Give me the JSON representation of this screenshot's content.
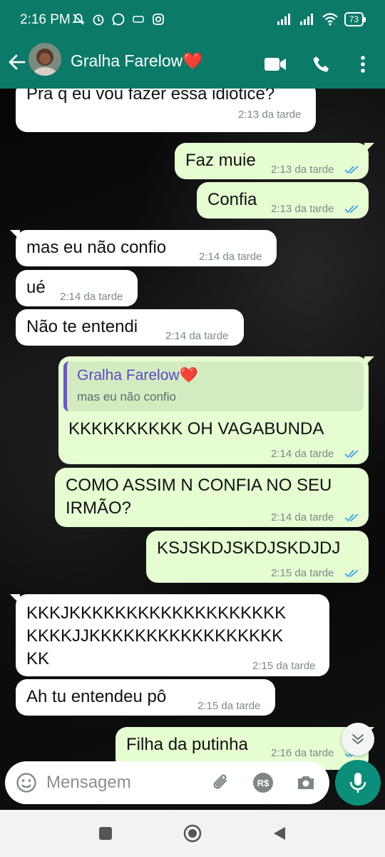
{
  "status_bar": {
    "time": "2:16 PM",
    "battery": "73"
  },
  "header": {
    "contact_name": "Gralha Farelow❤️"
  },
  "messages": [
    {
      "text": "Pra q eu vou fazer essa idiotice?",
      "time": "2:13 da tarde",
      "direction": "in"
    },
    {
      "text": "Faz muie",
      "time": "2:13 da tarde",
      "direction": "out",
      "read": true
    },
    {
      "text": "Confia",
      "time": "2:13 da tarde",
      "direction": "out",
      "read": true
    },
    {
      "text": "mas eu não confio",
      "time": "2:14 da tarde",
      "direction": "in"
    },
    {
      "text": "ué",
      "time": "2:14 da tarde",
      "direction": "in"
    },
    {
      "text": "Não te entendi",
      "time": "2:14 da tarde",
      "direction": "in"
    },
    {
      "text": "KKKKKKKKKK OH VAGABUNDA",
      "time": "2:14 da tarde",
      "direction": "out",
      "read": true,
      "quoted": {
        "name": "Gralha Farelow❤️",
        "text": "mas eu não confio"
      }
    },
    {
      "text_lines": [
        "COMO ASSIM N CONFIA NO SEU",
        "IRMÃO?"
      ],
      "time": "2:14 da tarde",
      "direction": "out",
      "read": true
    },
    {
      "text": "KSJSKDJSKDJSKDJDJ",
      "time": "2:15 da tarde",
      "direction": "out",
      "read": true
    },
    {
      "text_lines": [
        "KKKJKKKKKKKKKKKKKKKKKKK",
        "KKKKJJKKKKKKKKKKKKKKKKK",
        "KK"
      ],
      "time": "2:15 da tarde",
      "direction": "in"
    },
    {
      "text": "Ah tu entendeu pô",
      "time": "2:15 da tarde",
      "direction": "in"
    },
    {
      "text": "Filha da putinha",
      "time": "2:16 da tarde",
      "direction": "out",
      "read": true
    }
  ],
  "composer": {
    "placeholder": "Mensagem"
  },
  "colors": {
    "header": "#0b7a68",
    "outgoing": "#e6fdd2",
    "incoming": "#ffffff",
    "read_ticks": "#3ea4e8",
    "mic": "#0b8f7b"
  },
  "icons": [
    "back-arrow-icon",
    "video-call-icon",
    "phone-icon",
    "more-options-icon",
    "emoji-icon",
    "attach-icon",
    "payment-icon",
    "camera-icon",
    "mic-icon",
    "scroll-down-icon"
  ]
}
